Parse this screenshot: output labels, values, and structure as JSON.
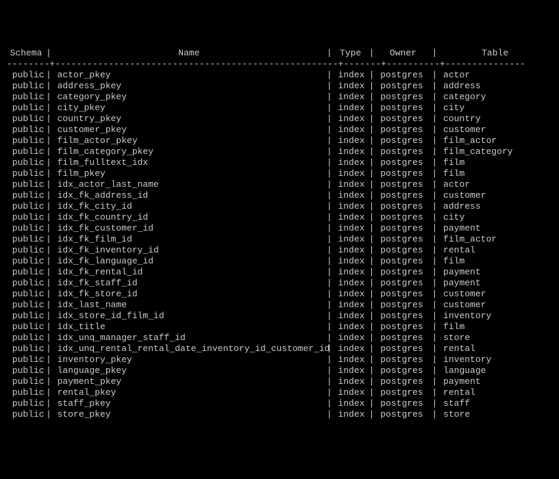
{
  "headers": {
    "schema": "Schema",
    "name": "Name",
    "type": "Type",
    "owner": "Owner",
    "table": "Table"
  },
  "rows": [
    {
      "schema": "public",
      "name": "actor_pkey",
      "type": "index",
      "owner": "postgres",
      "table": "actor"
    },
    {
      "schema": "public",
      "name": "address_pkey",
      "type": "index",
      "owner": "postgres",
      "table": "address"
    },
    {
      "schema": "public",
      "name": "category_pkey",
      "type": "index",
      "owner": "postgres",
      "table": "category"
    },
    {
      "schema": "public",
      "name": "city_pkey",
      "type": "index",
      "owner": "postgres",
      "table": "city"
    },
    {
      "schema": "public",
      "name": "country_pkey",
      "type": "index",
      "owner": "postgres",
      "table": "country"
    },
    {
      "schema": "public",
      "name": "customer_pkey",
      "type": "index",
      "owner": "postgres",
      "table": "customer"
    },
    {
      "schema": "public",
      "name": "film_actor_pkey",
      "type": "index",
      "owner": "postgres",
      "table": "film_actor"
    },
    {
      "schema": "public",
      "name": "film_category_pkey",
      "type": "index",
      "owner": "postgres",
      "table": "film_category"
    },
    {
      "schema": "public",
      "name": "film_fulltext_idx",
      "type": "index",
      "owner": "postgres",
      "table": "film"
    },
    {
      "schema": "public",
      "name": "film_pkey",
      "type": "index",
      "owner": "postgres",
      "table": "film"
    },
    {
      "schema": "public",
      "name": "idx_actor_last_name",
      "type": "index",
      "owner": "postgres",
      "table": "actor"
    },
    {
      "schema": "public",
      "name": "idx_fk_address_id",
      "type": "index",
      "owner": "postgres",
      "table": "customer"
    },
    {
      "schema": "public",
      "name": "idx_fk_city_id",
      "type": "index",
      "owner": "postgres",
      "table": "address"
    },
    {
      "schema": "public",
      "name": "idx_fk_country_id",
      "type": "index",
      "owner": "postgres",
      "table": "city"
    },
    {
      "schema": "public",
      "name": "idx_fk_customer_id",
      "type": "index",
      "owner": "postgres",
      "table": "payment"
    },
    {
      "schema": "public",
      "name": "idx_fk_film_id",
      "type": "index",
      "owner": "postgres",
      "table": "film_actor"
    },
    {
      "schema": "public",
      "name": "idx_fk_inventory_id",
      "type": "index",
      "owner": "postgres",
      "table": "rental"
    },
    {
      "schema": "public",
      "name": "idx_fk_language_id",
      "type": "index",
      "owner": "postgres",
      "table": "film"
    },
    {
      "schema": "public",
      "name": "idx_fk_rental_id",
      "type": "index",
      "owner": "postgres",
      "table": "payment"
    },
    {
      "schema": "public",
      "name": "idx_fk_staff_id",
      "type": "index",
      "owner": "postgres",
      "table": "payment"
    },
    {
      "schema": "public",
      "name": "idx_fk_store_id",
      "type": "index",
      "owner": "postgres",
      "table": "customer"
    },
    {
      "schema": "public",
      "name": "idx_last_name",
      "type": "index",
      "owner": "postgres",
      "table": "customer"
    },
    {
      "schema": "public",
      "name": "idx_store_id_film_id",
      "type": "index",
      "owner": "postgres",
      "table": "inventory"
    },
    {
      "schema": "public",
      "name": "idx_title",
      "type": "index",
      "owner": "postgres",
      "table": "film"
    },
    {
      "schema": "public",
      "name": "idx_unq_manager_staff_id",
      "type": "index",
      "owner": "postgres",
      "table": "store"
    },
    {
      "schema": "public",
      "name": "idx_unq_rental_rental_date_inventory_id_customer_id",
      "type": "index",
      "owner": "postgres",
      "table": "rental"
    },
    {
      "schema": "public",
      "name": "inventory_pkey",
      "type": "index",
      "owner": "postgres",
      "table": "inventory"
    },
    {
      "schema": "public",
      "name": "language_pkey",
      "type": "index",
      "owner": "postgres",
      "table": "language"
    },
    {
      "schema": "public",
      "name": "payment_pkey",
      "type": "index",
      "owner": "postgres",
      "table": "payment"
    },
    {
      "schema": "public",
      "name": "rental_pkey",
      "type": "index",
      "owner": "postgres",
      "table": "rental"
    },
    {
      "schema": "public",
      "name": "staff_pkey",
      "type": "index",
      "owner": "postgres",
      "table": "staff"
    },
    {
      "schema": "public",
      "name": "store_pkey",
      "type": "index",
      "owner": "postgres",
      "table": "store"
    }
  ]
}
